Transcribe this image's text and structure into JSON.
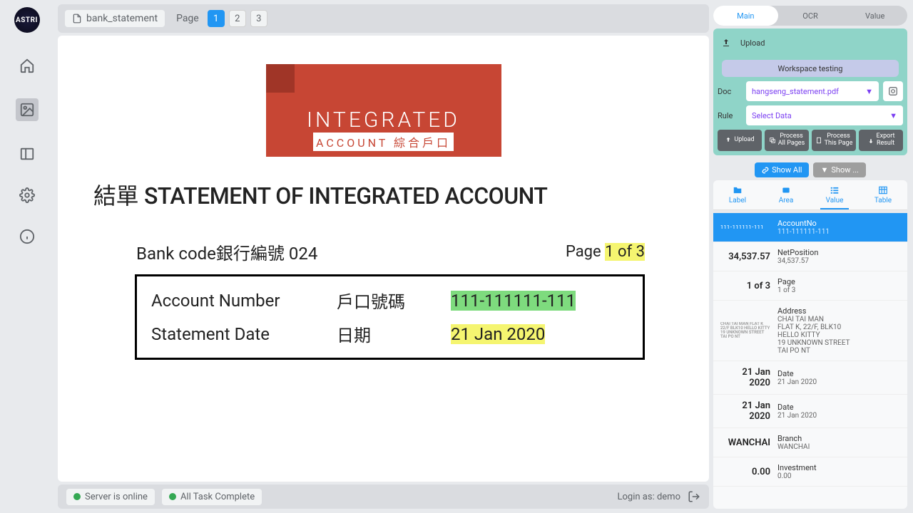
{
  "app": {
    "logo_text": "ASTRI"
  },
  "sidebar_icons": [
    "home",
    "image",
    "panel",
    "settings",
    "info"
  ],
  "header": {
    "doc_name": "bank_statement",
    "page_label": "Page",
    "pages": [
      "1",
      "2",
      "3"
    ],
    "active_page": "1"
  },
  "document": {
    "logo_top": "INTEGRATED",
    "logo_bottom": "ACCOUNT 綜合戶口",
    "title_cn": "結單",
    "title_en": "STATEMENT OF INTEGRATED ACCOUNT",
    "bank_code_label": "Bank code銀行編號 024",
    "page_prefix": "Page ",
    "page_value": "1 of 3",
    "rows": [
      {
        "en": "Account Number",
        "cn": "戶口號碼",
        "val": "111-111111-111",
        "hl": "green"
      },
      {
        "en": "Statement Date",
        "cn": "日期",
        "val": "21 Jan 2020",
        "hl": "yellow"
      }
    ]
  },
  "status": {
    "server": "Server is online",
    "task": "All Task Complete",
    "login_as": "Login as: demo"
  },
  "right": {
    "top_tabs": [
      "Main",
      "OCR",
      "Value"
    ],
    "active_top_tab": "Main",
    "upload_label": "Upload",
    "workspace": "Workspace testing",
    "doc_label": "Doc",
    "doc_value": "hangseng_statement.pdf",
    "rule_label": "Rule",
    "rule_value": "Select Data",
    "buttons": {
      "upload": "Upload",
      "proc_all_t": "Process",
      "proc_all_b": "All Pages",
      "proc_this_t": "Process",
      "proc_this_b": "This Page",
      "export_t": "Export",
      "export_b": "Result"
    },
    "show_all": "Show All",
    "show_more": "Show ...",
    "sub_tabs": [
      "Label",
      "Area",
      "Value",
      "Table"
    ],
    "active_sub_tab": "Value",
    "values": [
      {
        "left": "111-111111-111",
        "name": "AccountNo",
        "sub": "111-111111-111",
        "thumb": true,
        "selected": true
      },
      {
        "left": "34,537.57",
        "name": "NetPosition",
        "sub": "34,537.57"
      },
      {
        "left": "1 of 3",
        "name": "Page",
        "sub": "1 of 3"
      },
      {
        "left": "CHAI TAI MAN FLAT K 22/F BLK10 HELLO KITTY 19 UNKNOWN STREET TAI PO NT",
        "name": "Address",
        "sub": "CHAI TAI MAN\nFLAT K, 22/F, BLK10\nHELLO KITTY\n19 UNKNOWN STREET\nTAI PO NT",
        "thumb": true
      },
      {
        "left": "21 Jan 2020",
        "name": "Date",
        "sub": "21 Jan 2020"
      },
      {
        "left": "21 Jan 2020",
        "name": "Date",
        "sub": "21 Jan 2020"
      },
      {
        "left": "WANCHAI",
        "name": "Branch",
        "sub": "WANCHAI"
      },
      {
        "left": "0.00",
        "name": "Investment",
        "sub": "0.00"
      }
    ]
  }
}
